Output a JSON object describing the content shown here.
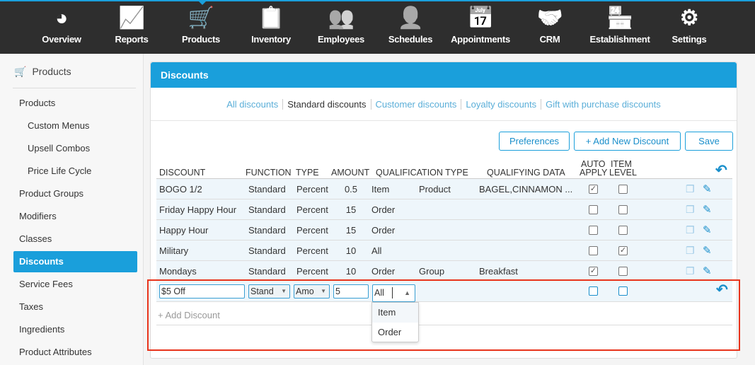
{
  "nav": [
    {
      "label": "Overview",
      "icon": "gauge-icon"
    },
    {
      "label": "Reports",
      "icon": "chart-icon"
    },
    {
      "label": "Products",
      "icon": "cart-icon"
    },
    {
      "label": "Inventory",
      "icon": "clipboard-icon"
    },
    {
      "label": "Employees",
      "icon": "people-icon"
    },
    {
      "label": "Schedules",
      "icon": "person-clock-icon"
    },
    {
      "label": "Appointments",
      "icon": "calendar-icon"
    },
    {
      "label": "CRM",
      "icon": "handshake-icon"
    },
    {
      "label": "Establishment",
      "icon": "store-icon"
    },
    {
      "label": "Settings",
      "icon": "gear-icon"
    }
  ],
  "sidebar": {
    "title": "Products",
    "items": [
      "Products",
      "Custom Menus",
      "Upsell Combos",
      "Price Life Cycle",
      "Product Groups",
      "Modifiers",
      "Classes",
      "Discounts",
      "Service Fees",
      "Taxes",
      "Ingredients",
      "Product Attributes"
    ]
  },
  "panel": {
    "title": "Discounts",
    "tabs": [
      "All discounts",
      "Standard discounts",
      "Customer discounts",
      "Loyalty discounts",
      "Gift with purchase discounts"
    ],
    "buttons": {
      "preferences": "Preferences",
      "add_new": "+ Add New Discount",
      "save": "Save"
    },
    "headers": {
      "discount": "DISCOUNT",
      "function": "FUNCTION",
      "type": "TYPE",
      "amount": "AMOUNT",
      "qualification_type": "QUALIFICATION TYPE",
      "qualifying_data": "QUALIFYING DATA",
      "auto_apply_1": "AUTO",
      "auto_apply_2": "APPLY",
      "item_level_1": "ITEM",
      "item_level_2": "LEVEL"
    },
    "rows": [
      {
        "discount": "BOGO 1/2",
        "function": "Standard",
        "type": "Percent",
        "amount": "0.5",
        "qual": "Item",
        "qual2": "Product",
        "data": "BAGEL,CINNAMON ...",
        "auto": true,
        "item": false
      },
      {
        "discount": "Friday Happy Hour",
        "function": "Standard",
        "type": "Percent",
        "amount": "15",
        "qual": "Order",
        "qual2": "",
        "data": "",
        "auto": false,
        "item": false
      },
      {
        "discount": "Happy Hour",
        "function": "Standard",
        "type": "Percent",
        "amount": "15",
        "qual": "Order",
        "qual2": "",
        "data": "",
        "auto": false,
        "item": false
      },
      {
        "discount": "Military",
        "function": "Standard",
        "type": "Percent",
        "amount": "10",
        "qual": "All",
        "qual2": "",
        "data": "",
        "auto": false,
        "item": true
      },
      {
        "discount": "Mondays",
        "function": "Standard",
        "type": "Percent",
        "amount": "10",
        "qual": "Order",
        "qual2": "Group",
        "data": "Breakfast",
        "auto": true,
        "item": false
      }
    ],
    "edit_row": {
      "name": "$5 Off",
      "function": "Stand",
      "type": "Amo",
      "amount": "5",
      "qual": "All",
      "options": [
        "Item",
        "Order"
      ]
    },
    "add_discount": "+ Add Discount"
  }
}
